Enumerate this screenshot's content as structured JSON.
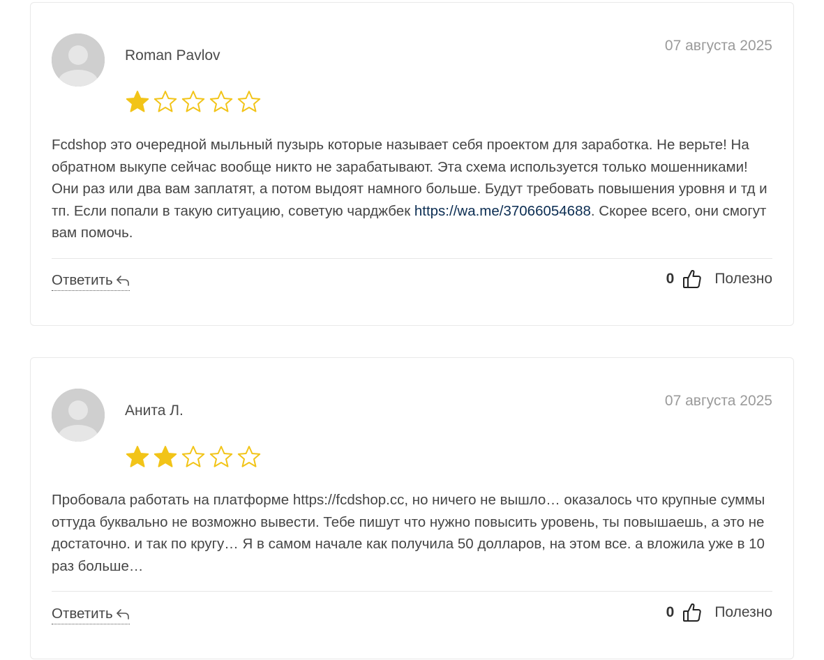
{
  "colors": {
    "star_filled": "#F2C418",
    "star_empty_stroke": "#F2C418",
    "link": "#0b2d52",
    "date": "#9a9a9a"
  },
  "reviews": [
    {
      "author": "Roman Pavlov",
      "date": "07 августа 2025",
      "rating": 1,
      "max_rating": 5,
      "text_before_link": "Fcdshop это очередной мыльный пузырь которые называет себя проектом для заработка. Не верьте! На обратном выкупе сейчас вообще никто не зарабатывают. Эта схема используется только мошенниками! Они раз или два вам заплатят, а потом выдоят намного больше. Будут требовать повышения уровня и тд и тп. Если попали в такую ситуацию, советую чарджбек ",
      "link_text": "https://wa.me/37066054688",
      "text_after_link": ". Скорее всего, они смогут вам помочь.",
      "reply_label": "Ответить",
      "helpful_count": "0",
      "helpful_label": "Полезно"
    },
    {
      "author": "Анита Л.",
      "date": "07 августа 2025",
      "rating": 2,
      "max_rating": 5,
      "text": "Пробовала работать на платформе https://fcdshop.cc, но ничего не вышло… оказалось что крупные суммы оттуда буквально не возможно вывести. Тебе пишут что нужно повысить уровень, ты повышаешь, а это не достаточно. и так по кругу… Я в самом начале как получила 50 долларов, на этом все. а вложила уже в 10 раз больше…",
      "reply_label": "Ответить",
      "helpful_count": "0",
      "helpful_label": "Полезно"
    }
  ]
}
